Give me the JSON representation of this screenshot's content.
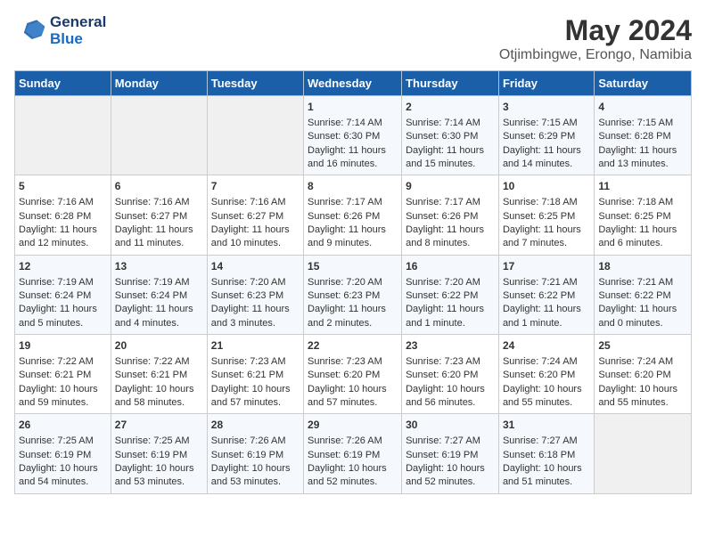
{
  "header": {
    "logo_line1": "General",
    "logo_line2": "Blue",
    "main_title": "May 2024",
    "subtitle": "Otjimbingwe, Erongo, Namibia"
  },
  "weekdays": [
    "Sunday",
    "Monday",
    "Tuesday",
    "Wednesday",
    "Thursday",
    "Friday",
    "Saturday"
  ],
  "weeks": [
    [
      {
        "day": "",
        "empty": true
      },
      {
        "day": "",
        "empty": true
      },
      {
        "day": "",
        "empty": true
      },
      {
        "day": "1",
        "sunrise": "7:14 AM",
        "sunset": "6:30 PM",
        "daylight": "11 hours and 16 minutes."
      },
      {
        "day": "2",
        "sunrise": "7:14 AM",
        "sunset": "6:30 PM",
        "daylight": "11 hours and 15 minutes."
      },
      {
        "day": "3",
        "sunrise": "7:15 AM",
        "sunset": "6:29 PM",
        "daylight": "11 hours and 14 minutes."
      },
      {
        "day": "4",
        "sunrise": "7:15 AM",
        "sunset": "6:28 PM",
        "daylight": "11 hours and 13 minutes."
      }
    ],
    [
      {
        "day": "5",
        "sunrise": "7:16 AM",
        "sunset": "6:28 PM",
        "daylight": "11 hours and 12 minutes."
      },
      {
        "day": "6",
        "sunrise": "7:16 AM",
        "sunset": "6:27 PM",
        "daylight": "11 hours and 11 minutes."
      },
      {
        "day": "7",
        "sunrise": "7:16 AM",
        "sunset": "6:27 PM",
        "daylight": "11 hours and 10 minutes."
      },
      {
        "day": "8",
        "sunrise": "7:17 AM",
        "sunset": "6:26 PM",
        "daylight": "11 hours and 9 minutes."
      },
      {
        "day": "9",
        "sunrise": "7:17 AM",
        "sunset": "6:26 PM",
        "daylight": "11 hours and 8 minutes."
      },
      {
        "day": "10",
        "sunrise": "7:18 AM",
        "sunset": "6:25 PM",
        "daylight": "11 hours and 7 minutes."
      },
      {
        "day": "11",
        "sunrise": "7:18 AM",
        "sunset": "6:25 PM",
        "daylight": "11 hours and 6 minutes."
      }
    ],
    [
      {
        "day": "12",
        "sunrise": "7:19 AM",
        "sunset": "6:24 PM",
        "daylight": "11 hours and 5 minutes."
      },
      {
        "day": "13",
        "sunrise": "7:19 AM",
        "sunset": "6:24 PM",
        "daylight": "11 hours and 4 minutes."
      },
      {
        "day": "14",
        "sunrise": "7:20 AM",
        "sunset": "6:23 PM",
        "daylight": "11 hours and 3 minutes."
      },
      {
        "day": "15",
        "sunrise": "7:20 AM",
        "sunset": "6:23 PM",
        "daylight": "11 hours and 2 minutes."
      },
      {
        "day": "16",
        "sunrise": "7:20 AM",
        "sunset": "6:22 PM",
        "daylight": "11 hours and 1 minute."
      },
      {
        "day": "17",
        "sunrise": "7:21 AM",
        "sunset": "6:22 PM",
        "daylight": "11 hours and 1 minute."
      },
      {
        "day": "18",
        "sunrise": "7:21 AM",
        "sunset": "6:22 PM",
        "daylight": "11 hours and 0 minutes."
      }
    ],
    [
      {
        "day": "19",
        "sunrise": "7:22 AM",
        "sunset": "6:21 PM",
        "daylight": "10 hours and 59 minutes."
      },
      {
        "day": "20",
        "sunrise": "7:22 AM",
        "sunset": "6:21 PM",
        "daylight": "10 hours and 58 minutes."
      },
      {
        "day": "21",
        "sunrise": "7:23 AM",
        "sunset": "6:21 PM",
        "daylight": "10 hours and 57 minutes."
      },
      {
        "day": "22",
        "sunrise": "7:23 AM",
        "sunset": "6:20 PM",
        "daylight": "10 hours and 57 minutes."
      },
      {
        "day": "23",
        "sunrise": "7:23 AM",
        "sunset": "6:20 PM",
        "daylight": "10 hours and 56 minutes."
      },
      {
        "day": "24",
        "sunrise": "7:24 AM",
        "sunset": "6:20 PM",
        "daylight": "10 hours and 55 minutes."
      },
      {
        "day": "25",
        "sunrise": "7:24 AM",
        "sunset": "6:20 PM",
        "daylight": "10 hours and 55 minutes."
      }
    ],
    [
      {
        "day": "26",
        "sunrise": "7:25 AM",
        "sunset": "6:19 PM",
        "daylight": "10 hours and 54 minutes."
      },
      {
        "day": "27",
        "sunrise": "7:25 AM",
        "sunset": "6:19 PM",
        "daylight": "10 hours and 53 minutes."
      },
      {
        "day": "28",
        "sunrise": "7:26 AM",
        "sunset": "6:19 PM",
        "daylight": "10 hours and 53 minutes."
      },
      {
        "day": "29",
        "sunrise": "7:26 AM",
        "sunset": "6:19 PM",
        "daylight": "10 hours and 52 minutes."
      },
      {
        "day": "30",
        "sunrise": "7:27 AM",
        "sunset": "6:19 PM",
        "daylight": "10 hours and 52 minutes."
      },
      {
        "day": "31",
        "sunrise": "7:27 AM",
        "sunset": "6:18 PM",
        "daylight": "10 hours and 51 minutes."
      },
      {
        "day": "",
        "empty": true
      }
    ]
  ],
  "labels": {
    "sunrise_prefix": "Sunrise: ",
    "sunset_prefix": "Sunset: ",
    "daylight_prefix": "Daylight: "
  }
}
